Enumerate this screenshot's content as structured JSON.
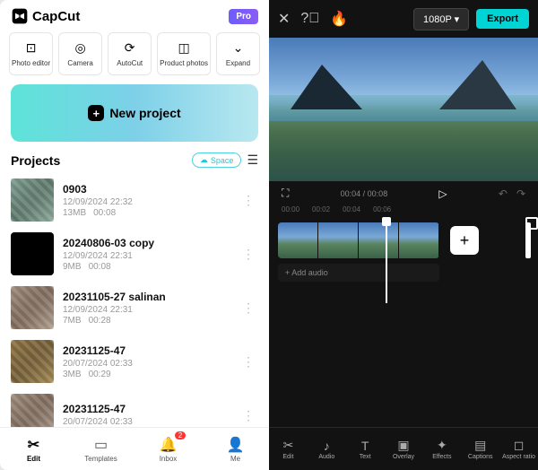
{
  "header": {
    "app_name": "CapCut",
    "pro_label": "Pro"
  },
  "tools": [
    {
      "icon": "⊡",
      "label": "Photo editor"
    },
    {
      "icon": "◎",
      "label": "Camera"
    },
    {
      "icon": "⟳",
      "label": "AutoCut"
    },
    {
      "icon": "◫",
      "label": "Product photos"
    },
    {
      "icon": "⌄",
      "label": "Expand"
    }
  ],
  "new_project_label": "New project",
  "projects_title": "Projects",
  "space_label": "Space",
  "projects": [
    {
      "name": "0903",
      "date": "12/09/2024 22:32",
      "size": "13MB",
      "duration": "00:08",
      "thumb_class": "blur"
    },
    {
      "name": "20240806-03 copy",
      "date": "12/09/2024 22:31",
      "size": "9MB",
      "duration": "00:08",
      "thumb_class": ""
    },
    {
      "name": "20231105-27 salinan",
      "date": "12/09/2024 22:31",
      "size": "7MB",
      "duration": "00:28",
      "thumb_class": "blur blur3"
    },
    {
      "name": "20231125-47",
      "date": "20/07/2024 02:33",
      "size": "3MB",
      "duration": "00:29",
      "thumb_class": "blur blur2"
    },
    {
      "name": "20231125-47",
      "date": "20/07/2024 02:33",
      "size": "",
      "duration": "",
      "thumb_class": "blur blur3"
    }
  ],
  "bottom_nav": [
    {
      "icon": "✂",
      "label": "Edit",
      "active": true,
      "badge": null
    },
    {
      "icon": "▭",
      "label": "Templates",
      "active": false,
      "badge": null
    },
    {
      "icon": "🔔",
      "label": "Inbox",
      "active": false,
      "badge": "2"
    },
    {
      "icon": "👤",
      "label": "Me",
      "active": false,
      "badge": null
    }
  ],
  "editor": {
    "resolution": "1080P ▾",
    "export_label": "Export",
    "current_time": "00:04",
    "total_time": "00:08",
    "ruler": [
      "00:00",
      "00:02",
      "00:04",
      "00:06"
    ],
    "add_audio_label": "+ Add audio",
    "toolbar": [
      {
        "icon": "✂",
        "label": "Edit"
      },
      {
        "icon": "♪",
        "label": "Audio"
      },
      {
        "icon": "T",
        "label": "Text"
      },
      {
        "icon": "▣",
        "label": "Overlay"
      },
      {
        "icon": "✦",
        "label": "Effects"
      },
      {
        "icon": "▤",
        "label": "Captions"
      },
      {
        "icon": "◻",
        "label": "Aspect ratio"
      }
    ]
  }
}
